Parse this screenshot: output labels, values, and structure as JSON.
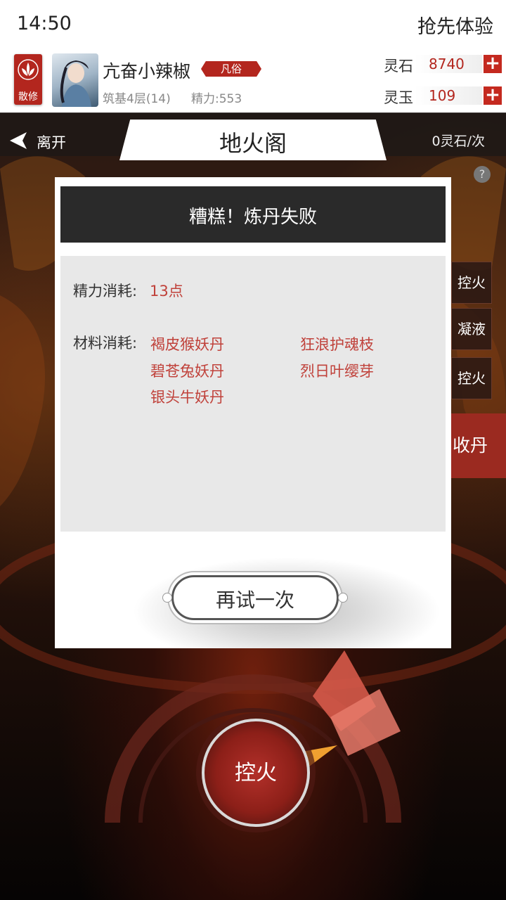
{
  "status_bar": {
    "time": "14:50",
    "right_text": "抢先体验"
  },
  "player": {
    "sect_label": "散修",
    "name": "亢奋小辣椒",
    "rank": "凡俗",
    "realm": "筑基4层(14)",
    "energy": "精力:553"
  },
  "currencies": [
    {
      "label": "灵石",
      "value": "8740"
    },
    {
      "label": "灵玉",
      "value": "109"
    }
  ],
  "top_bar": {
    "leave_label": "离开",
    "title": "地火阁",
    "cost": "0灵石/次"
  },
  "side_buttons": [
    "控火",
    "凝液",
    "控火"
  ],
  "collect_button": "收丹",
  "fire_button": "控火",
  "modal": {
    "title": "糟糕！炼丹失败",
    "energy_label": "精力消耗:",
    "energy_value": "13点",
    "material_label": "材料消耗:",
    "materials": [
      "褐皮猴妖丹",
      "狂浪护魂枝",
      "碧苍兔妖丹",
      "烈日叶缨芽",
      "银头牛妖丹"
    ],
    "retry_button": "再试一次"
  },
  "colors": {
    "accent_red": "#b3261e",
    "value_red": "#c0413a"
  }
}
